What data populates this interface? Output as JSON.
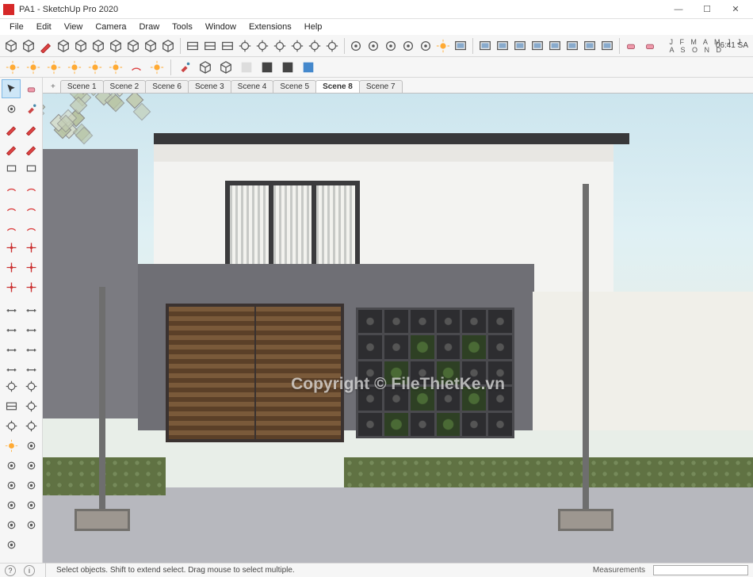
{
  "window": {
    "title": "PA1 - SketchUp Pro 2020"
  },
  "menu": [
    "File",
    "Edit",
    "View",
    "Camera",
    "Draw",
    "Tools",
    "Window",
    "Extensions",
    "Help"
  ],
  "brand": {
    "p1": "File",
    "p2": "ThietKe",
    "p3": ".vn"
  },
  "clock": "06:41 SA",
  "months": "J F M A M J J A S O N D",
  "scenes": {
    "add": "+",
    "tabs": [
      {
        "label": "Scene 1",
        "active": false
      },
      {
        "label": "Scene 2",
        "active": false
      },
      {
        "label": "Scene 6",
        "active": false
      },
      {
        "label": "Scene 3",
        "active": false
      },
      {
        "label": "Scene 4",
        "active": false
      },
      {
        "label": "Scene 5",
        "active": false
      },
      {
        "label": "Scene 8",
        "active": true
      },
      {
        "label": "Scene 7",
        "active": false
      }
    ]
  },
  "status": {
    "hint": "Select objects. Shift to extend select. Drag mouse to select multiple.",
    "measure_label": "Measurements"
  },
  "viewport_watermark": "Copyright © FileThietKe.vn",
  "toolbar1_icons": [
    "components",
    "layers",
    "outliner",
    "iso",
    "front",
    "back",
    "left",
    "right",
    "top",
    "bottom",
    "sep",
    "section",
    "section-fill",
    "section-cut",
    "walk",
    "orbit",
    "pan",
    "zoom",
    "zoom-window",
    "zoom-extents",
    "sep",
    "vray",
    "vray-render",
    "teapot",
    "teapot2",
    "cloud",
    "lightmix",
    "frame",
    "sep",
    "img",
    "img2",
    "img3",
    "img4",
    "screen",
    "screen2",
    "screen3",
    "lock",
    "sep",
    "eraser-shadow"
  ],
  "toolbar2_icons": [
    "sun",
    "horizon",
    "plane",
    "axis",
    "guide",
    "light",
    "circle",
    "shape",
    "sep",
    "materials",
    "box2",
    "box3",
    "sheet",
    "dark",
    "dark2",
    "blue"
  ],
  "palette_icons": [
    "select",
    "eraser",
    "camera",
    "paint",
    "pencil",
    "freehand",
    "line",
    "line2",
    "rect",
    "rect-rot",
    "arc",
    "arc2",
    "pie",
    "arc3",
    "poly",
    "circle",
    "pushpull",
    "offset",
    "move",
    "rotate",
    "follow",
    "scale",
    "tape",
    "text",
    "dim",
    "dim2",
    "protractor",
    "label",
    "axes",
    "axes2",
    "walk",
    "look",
    "section",
    "pan2",
    "orbit",
    "zoom",
    "sun2",
    "eye",
    "marker",
    "marker2",
    "marker3",
    "marker4",
    "3dw",
    "ext",
    "fog",
    "fog2",
    "style"
  ]
}
